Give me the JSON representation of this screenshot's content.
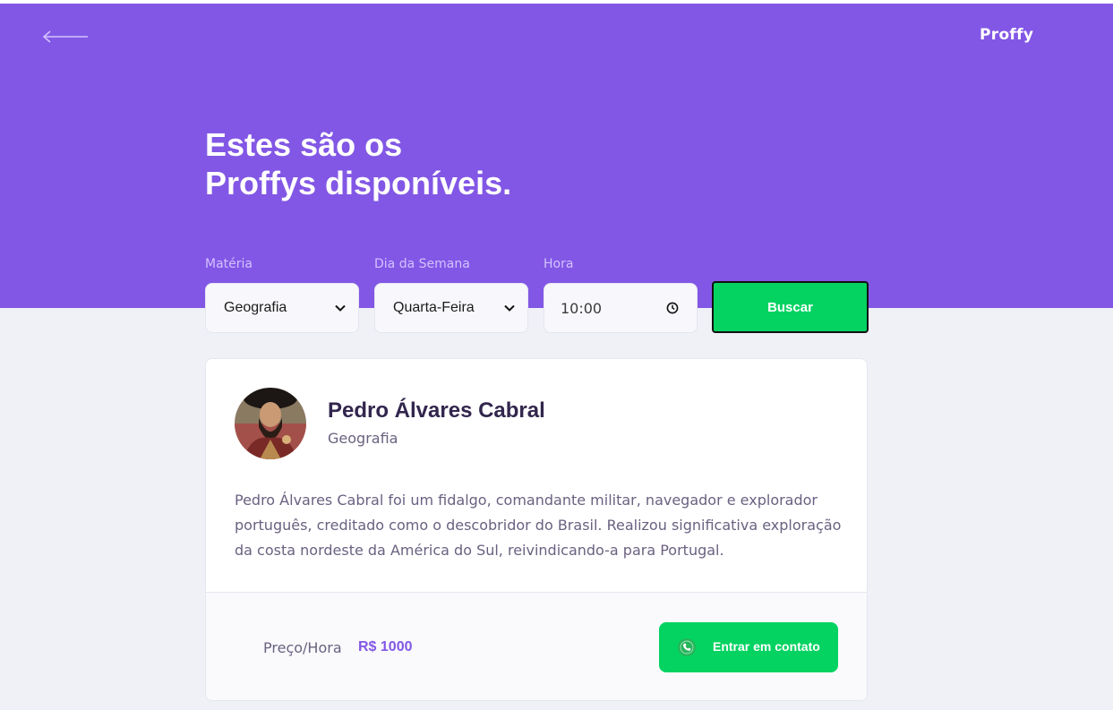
{
  "header": {
    "logo": "Proffy",
    "title_line1": "Estes são os",
    "title_line2": "Proffys disponíveis.",
    "color": "#8257E5"
  },
  "filters": {
    "subject_label": "Matéria",
    "subject_value": "Geografia",
    "weekday_label": "Dia da Semana",
    "weekday_value": "Quarta-Feira",
    "time_label": "Hora",
    "time_value": "10:00",
    "search_label": "Buscar"
  },
  "teacher": {
    "name": "Pedro Álvares Cabral",
    "subject": "Geografia",
    "bio": "Pedro Álvares Cabral foi um fidalgo, comandante militar, navegador e explorador português, creditado como o descobridor do Brasil. Realizou significativa exploração da costa nordeste da América do Sul, reivindicando-a para Portugal.",
    "price_label": "Preço/Hora",
    "price_value": "R$ 1000",
    "contact_label": "Entrar em contato"
  },
  "colors": {
    "primary": "#8257E5",
    "secondary": "#04D361",
    "background": "#F0F0F7",
    "title_text": "#32264D",
    "body_text": "#6A6180"
  },
  "icons": {
    "back": "arrow-left-icon",
    "dropdown": "chevron-down-icon",
    "clock": "clock-icon",
    "contact": "whatsapp-icon"
  }
}
